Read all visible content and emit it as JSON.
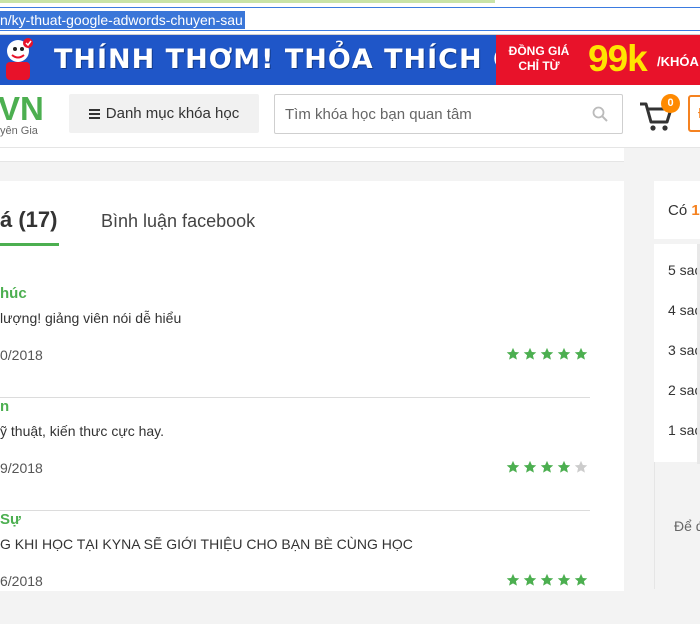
{
  "address_bar": {
    "url_text": "n/ky-thuat-google-adwords-chuyen-sau"
  },
  "banner": {
    "title": "THÍNH THƠM! THỎA THÍCH CHỌN",
    "promo_line1": "ĐỒNG GIÁ",
    "promo_line2": "CHỈ TỪ",
    "promo_price": "99k",
    "promo_tail": "/KHÓA",
    "colors": {
      "background": "#1f56c8",
      "promo_bg": "#e8122a",
      "price": "#ffe400"
    }
  },
  "header": {
    "logo_main": "VN",
    "logo_sub": "yên Gia",
    "category_button": "Danh mục khóa học",
    "search_placeholder": "Tìm khóa học bạn quan tâm",
    "cart_count": "0",
    "login_partial": "Đ"
  },
  "reviews_card": {
    "tabs": {
      "reviews_label": "á (17)",
      "facebook_label": "Bình luận facebook"
    },
    "items": [
      {
        "name": "húc",
        "text": "lượng! giảng viên nói dễ hiểu",
        "date": "0/2018",
        "rating": 5
      },
      {
        "name": "n",
        "text": "ỹ thuật, kiến thưc cực hay.",
        "date": "9/2018",
        "rating": 4
      },
      {
        "name": "Sự",
        "text": "G KHI HỌC TẠI KYNA SẼ GIỚI THIỆU CHO BẠN BÈ CÙNG HỌC",
        "date": "6/2018",
        "rating": 5
      }
    ],
    "colors": {
      "accent": "#4caf50",
      "star_on": "#4caf50",
      "star_off": "#cccccc"
    }
  },
  "sidebar": {
    "summary_prefix": "Có ",
    "summary_num": "1",
    "rows": [
      "5 sao",
      "4 sao",
      "3 sao",
      "2 sao",
      "1 sao"
    ],
    "bottom_text": "Để đ"
  }
}
